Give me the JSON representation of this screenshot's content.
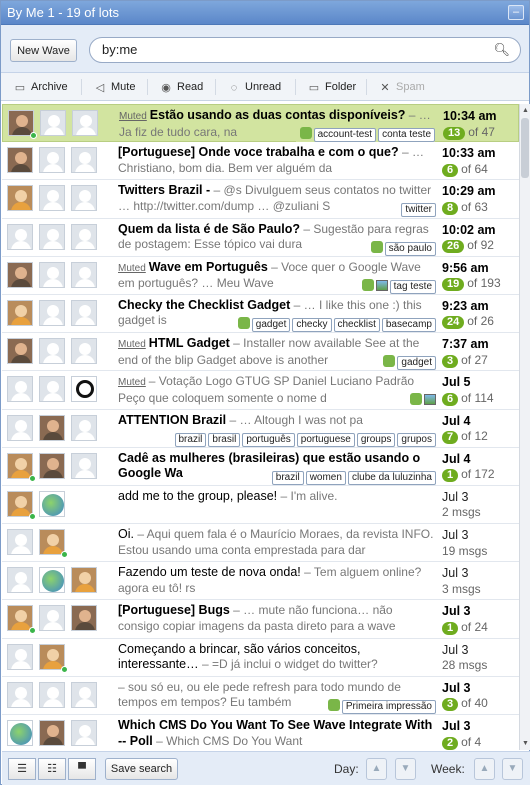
{
  "window": {
    "title": "By Me 1 - 19 of lots"
  },
  "search": {
    "new_wave": "New Wave",
    "query": "by:me"
  },
  "toolbar": {
    "archive": "Archive",
    "mute": "Mute",
    "read": "Read",
    "unread": "Unread",
    "folder": "Folder",
    "spam": "Spam"
  },
  "waves": [
    {
      "muted": "Muted",
      "subject": "Estão usando as duas contas disponíveis?",
      "snippet": "– … Ja fiz de tudo cara, na",
      "time": "10:34 am",
      "unread": "13",
      "total": "of 47",
      "tags": [
        "account-test",
        "conta teste"
      ],
      "gadget": true,
      "pic": false
    },
    {
      "muted": "",
      "subject": "[Portuguese] Onde voce trabalha e com o que?",
      "snippet": "– … Christiano, bom dia. Bem ver alguém da",
      "time": "10:33 am",
      "unread": "6",
      "total": "of 64",
      "tags": [],
      "gadget": false,
      "pic": false
    },
    {
      "muted": "",
      "subject": "Twitters Brazil -",
      "snippet": "– @s Divulguem seus contatos no twitter … http://twitter.com/dump … @zuliani S",
      "time": "10:29 am",
      "unread": "8",
      "total": "of 63",
      "tags": [
        "twitter"
      ],
      "gadget": false,
      "pic": false
    },
    {
      "muted": "",
      "subject": "Quem da lista é de São Paulo?",
      "snippet": "– Sugestão para regras de postagem: Esse tópico vai dura",
      "time": "10:02 am",
      "unread": "26",
      "total": "of 92",
      "tags": [
        "são paulo"
      ],
      "gadget": true,
      "pic": false
    },
    {
      "muted": "Muted",
      "subject": "Wave em Português",
      "snippet": "– Voce quer o Google Wave em português? … Meu Wave",
      "time": "9:56 am",
      "unread": "19",
      "total": "of 193",
      "tags": [
        "tag teste"
      ],
      "gadget": true,
      "pic": true
    },
    {
      "muted": "",
      "subject": "Checky the Checklist Gadget",
      "snippet": "– … I like this one :) this gadget is",
      "time": "9:23 am",
      "unread": "24",
      "total": "of 26",
      "tags": [
        "gadget",
        "checky",
        "checklist",
        "basecamp"
      ],
      "gadget": true,
      "pic": false
    },
    {
      "muted": "Muted",
      "subject": "HTML Gadget",
      "snippet": "– Installer now available See at the end of the blip Gadget above is another",
      "time": "7:37 am",
      "unread": "3",
      "total": "of 27",
      "tags": [
        "gadget"
      ],
      "gadget": true,
      "pic": false
    },
    {
      "muted": "Muted",
      "subject": "",
      "snippet": "– Votação Logo GTUG SP Daniel Luciano Padrão Peço que coloquem somente o nome d",
      "time": "Jul 5",
      "unread": "6",
      "total": "of 114",
      "tags": [],
      "gadget": true,
      "pic": true
    },
    {
      "muted": "",
      "subject": "ATTENTION Brazil",
      "snippet": "– … Altough I was not pa",
      "time": "Jul 4",
      "unread": "7",
      "total": "of 12",
      "tags": [
        "brazil",
        "brasil",
        "português",
        "portuguese",
        "groups",
        "grupos"
      ],
      "gadget": false,
      "pic": false
    },
    {
      "muted": "",
      "subject": "Cadê as mulheres (brasileiras) que estão usando o Google Wa",
      "snippet": "",
      "time": "Jul 4",
      "unread": "1",
      "total": "of 172",
      "tags": [
        "brazil",
        "women",
        "clube da luluzinha"
      ],
      "gadget": false,
      "pic": false
    },
    {
      "muted": "",
      "subject": "add me to the group, please!",
      "snippet": "– I'm alive.",
      "time": "Jul 3",
      "unread": "",
      "total": "2 msgs",
      "tags": [],
      "gadget": false,
      "pic": false
    },
    {
      "muted": "",
      "subject": "Oi.",
      "snippet": "– Aqui quem fala é o Maurício Moraes, da revista INFO. Estou usando uma conta emprestada para dar",
      "time": "Jul 3",
      "unread": "",
      "total": "19 msgs",
      "tags": [],
      "gadget": false,
      "pic": false
    },
    {
      "muted": "",
      "subject": "Fazendo um teste de nova onda!",
      "snippet": "– Tem alguem online? agora eu tô! rs",
      "time": "Jul 3",
      "unread": "",
      "total": "3 msgs",
      "tags": [],
      "gadget": false,
      "pic": false
    },
    {
      "muted": "",
      "subject": "[Portuguese] Bugs",
      "snippet": "– … mute não funciona… não consigo copiar imagens da pasta direto para a wave",
      "time": "Jul 3",
      "unread": "1",
      "total": "of 24",
      "tags": [],
      "gadget": false,
      "pic": false
    },
    {
      "muted": "",
      "subject": "Começando a brincar, são vários conceitos, interessante…",
      "snippet": "– =D já inclui o widget do twitter?",
      "time": "Jul 3",
      "unread": "",
      "total": "28 msgs",
      "tags": [],
      "gadget": false,
      "pic": false
    },
    {
      "muted": "",
      "subject": "",
      "snippet": "– sou só eu, ou ele pede refresh para todo mundo de tempos em tempos? Eu também",
      "time": "Jul 3",
      "unread": "3",
      "total": "of 40",
      "tags": [
        "Primeira impressão"
      ],
      "gadget": true,
      "pic": false
    },
    {
      "muted": "",
      "subject": "Which CMS Do You Want To See Wave Integrate With -- Poll",
      "snippet": "– Which CMS Do You Want",
      "time": "Jul 3",
      "unread": "2",
      "total": "of 4",
      "tags": [],
      "gadget": false,
      "pic": false
    }
  ],
  "footer": {
    "save_search": "Save search",
    "day": "Day:",
    "week": "Week:"
  },
  "colors": {
    "titlebar": "#6b95d3",
    "selected_row": "#d2e4a0",
    "unread_badge": "#6fac1f"
  }
}
